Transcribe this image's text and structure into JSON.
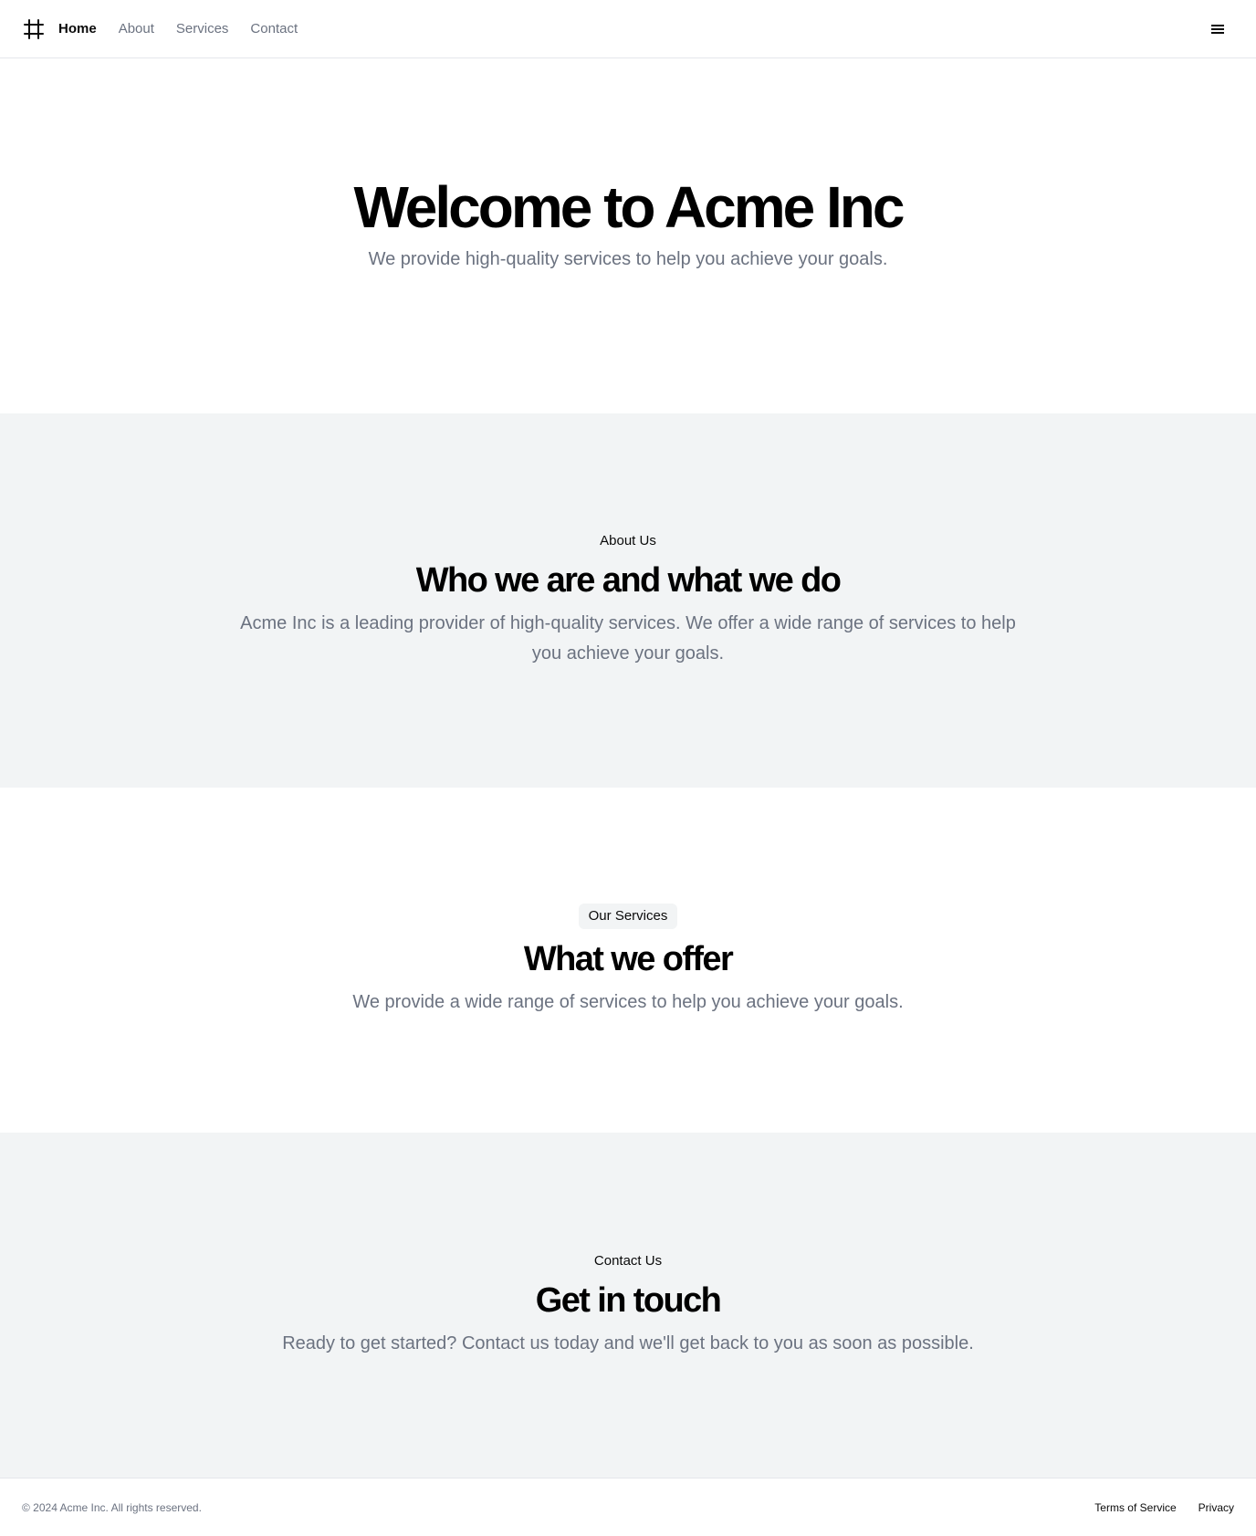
{
  "header": {
    "logo_icon": "hash-mountain-icon",
    "nav": [
      {
        "label": "Home",
        "active": true
      },
      {
        "label": "About",
        "active": false
      },
      {
        "label": "Services",
        "active": false
      },
      {
        "label": "Contact",
        "active": false
      }
    ],
    "menu_icon": "hamburger-menu-icon"
  },
  "hero": {
    "title": "Welcome to Acme Inc",
    "subtitle": "We provide high-quality services to help you achieve your goals."
  },
  "about": {
    "eyebrow": "About Us",
    "title": "Who we are and what we do",
    "description": "Acme Inc is a leading provider of high-quality services. We offer a wide range of services to help you achieve your goals."
  },
  "services": {
    "eyebrow": "Our Services",
    "title": "What we offer",
    "description": "We provide a wide range of services to help you achieve your goals."
  },
  "contact": {
    "eyebrow": "Contact Us",
    "title": "Get in touch",
    "description": "Ready to get started? Contact us today and we'll get back to you as soon as possible."
  },
  "footer": {
    "copyright": "© 2024 Acme Inc. All rights reserved.",
    "links": [
      "Terms of Service",
      "Privacy"
    ]
  },
  "colors": {
    "muted_text": "#6b7280",
    "section_alt_bg": "#f2f4f5",
    "border": "#e5e7eb"
  }
}
